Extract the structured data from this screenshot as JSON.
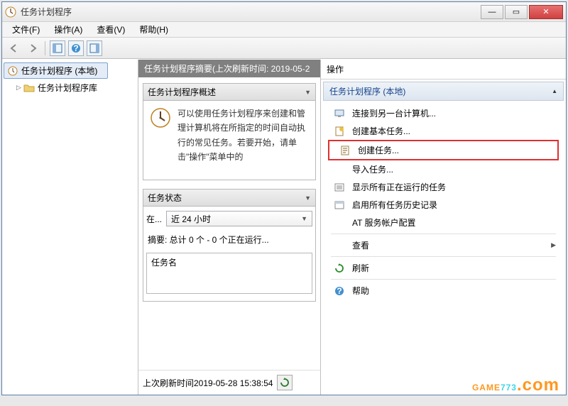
{
  "window": {
    "title": "任务计划程序"
  },
  "menu": {
    "file": "文件(F)",
    "action": "操作(A)",
    "view": "查看(V)",
    "help": "帮助(H)"
  },
  "tree": {
    "root": "任务计划程序 (本地)",
    "lib": "任务计划程序库"
  },
  "summary": {
    "header": "任务计划程序摘要(上次刷新时间: 2019-05-2",
    "overview_title": "任务计划程序概述",
    "overview_text": "可以使用任务计划程序来创建和管理计算机将在所指定的时间自动执行的常见任务。若要开始，请单击\"操作\"菜单中的",
    "status_title": "任务状态",
    "status_label": "在...",
    "status_combo": "近 24 小时",
    "summary_line": "摘要: 总计 0 个 - 0 个正在运行...",
    "task_names_label": "任务名",
    "last_refresh": "上次刷新时间2019-05-28 15:38:54"
  },
  "actions": {
    "header": "操作",
    "subheader": "任务计划程序 (本地)",
    "items": {
      "connect": "连接到另一台计算机...",
      "create_basic": "创建基本任务...",
      "create_task": "创建任务...",
      "import": "导入任务...",
      "show_running": "显示所有正在运行的任务",
      "enable_history": "启用所有任务历史记录",
      "at_service": "AT 服务帐户配置",
      "view": "查看",
      "refresh": "刷新",
      "help": "帮助"
    }
  },
  "watermark": {
    "p1": "GAME",
    "p2": "773",
    "p3": ".com"
  }
}
